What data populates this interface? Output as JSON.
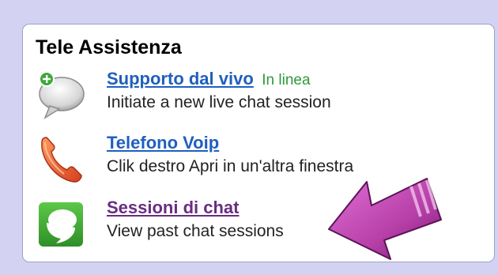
{
  "panel": {
    "title": "Tele Assistenza",
    "items": [
      {
        "icon": "chat-bubble-add-icon",
        "link": "Supporto dal vivo",
        "status": "In linea",
        "description": "Initiate a new live chat session"
      },
      {
        "icon": "phone-handset-icon",
        "link": "Telefono Voip",
        "description": "Clik destro Apri in un'altra finestra"
      },
      {
        "icon": "chat-history-icon",
        "link": "Sessioni di chat",
        "description": "View past chat sessions"
      }
    ]
  },
  "colors": {
    "background": "#d4d2f2",
    "link": "#1f5fbf",
    "visited_link": "#6a2c80",
    "online_status": "#2e9a3a",
    "arrow": "#b63fa8"
  }
}
